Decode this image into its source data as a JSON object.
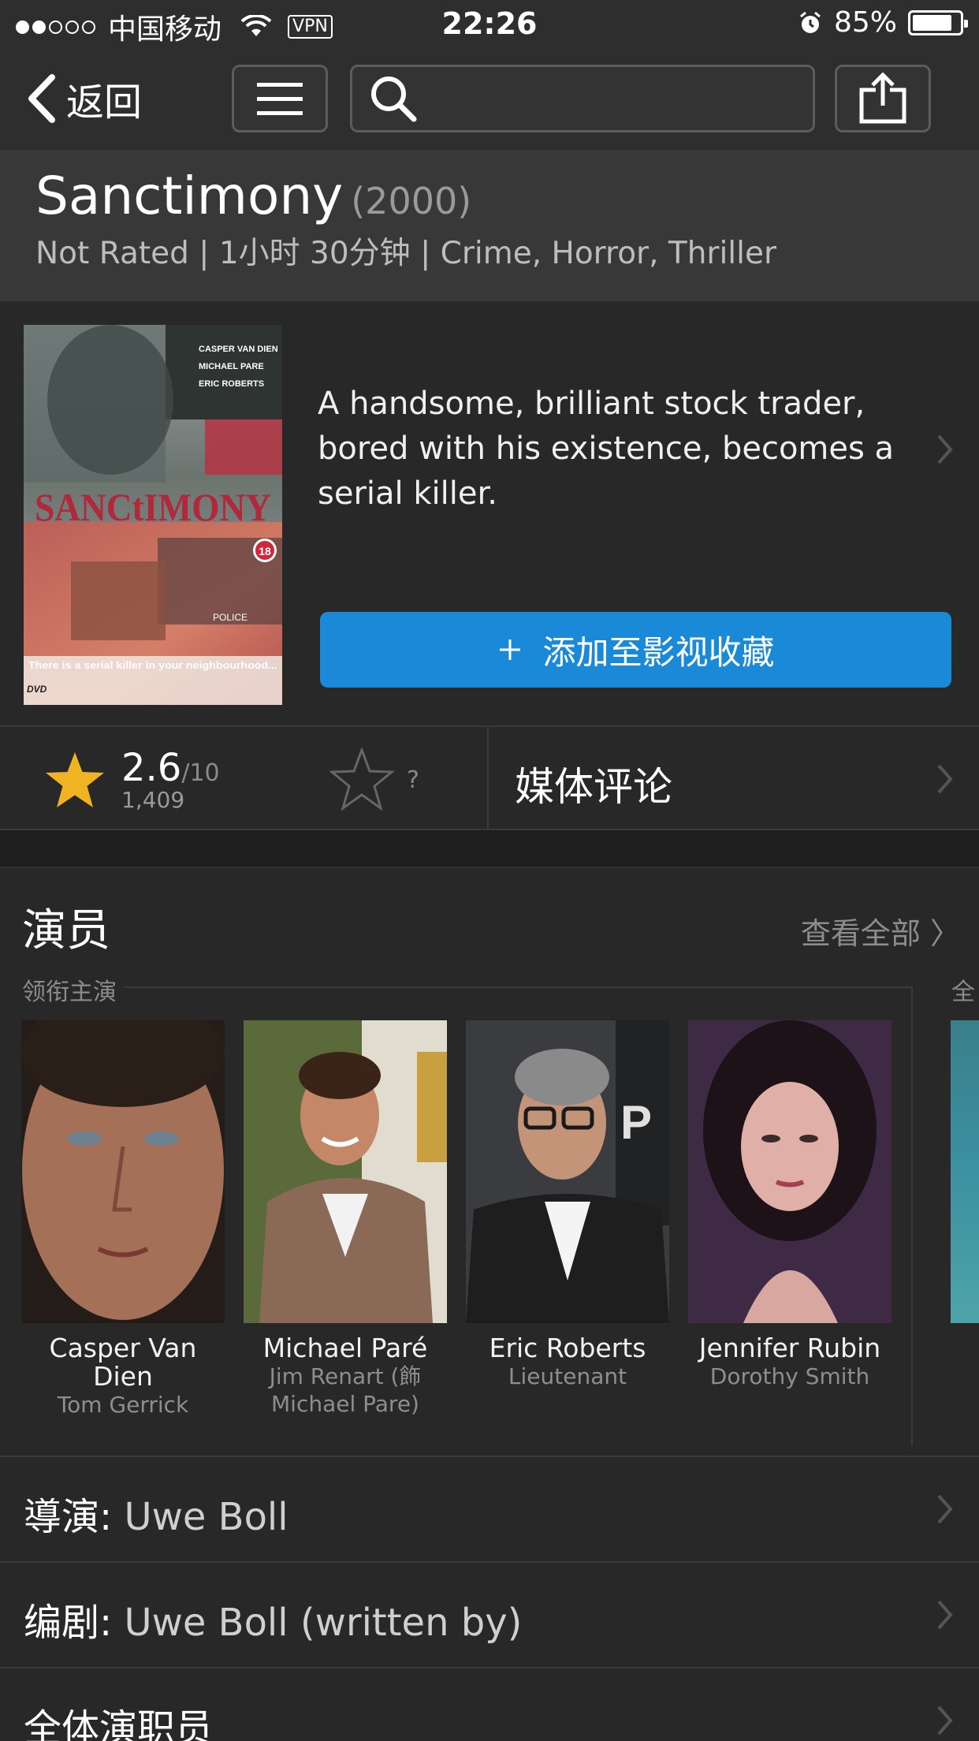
{
  "status_bar": {
    "carrier": "中国移动",
    "vpn": "VPN",
    "time": "22:26",
    "battery": "85%",
    "battery_level": 0.85
  },
  "nav": {
    "back_label": "返回",
    "search_placeholder": ""
  },
  "movie": {
    "title": "Sanctimony",
    "year": "(2000)",
    "meta": "Not Rated | 1小时 30分钟 | Crime, Horror, Thriller",
    "plot": "A handsome, brilliant stock trader, bored with his existence, becomes a serial killer.",
    "poster": {
      "credits": [
        "CASPER VAN DIEN",
        "MICHAEL PARE",
        "ERIC ROBERTS"
      ],
      "title": "SANCtIMONY",
      "rating_badge": "18",
      "tagline": "There is a serial killer in your neighbourhood...",
      "format": "DVD",
      "police_text": "POLICE"
    },
    "add_button": "添加至影视收藏",
    "add_icon": "plus-icon"
  },
  "rating": {
    "value": "2.6",
    "max": "/10",
    "count": "1,409",
    "user_rating": "?",
    "media_review": "媒体评论"
  },
  "cast": {
    "heading": "演员",
    "see_all": "查看全部 〉",
    "lead_label": "领衔主演",
    "next_label": "全",
    "members": [
      {
        "actor": "Casper Van Dien",
        "role": "Tom Gerrick"
      },
      {
        "actor": "Michael Paré",
        "role": "Jim Renart (飾 Michael Pare)"
      },
      {
        "actor": "Eric Roberts",
        "role": "Lieutenant"
      },
      {
        "actor": "Jennifer Rubin",
        "role": "Dorothy Smith"
      }
    ]
  },
  "credits": {
    "director_label": "導演:",
    "director": "Uwe Boll",
    "writer_label": "编剧:",
    "writer": "Uwe Boll (written by)",
    "full_cast": "全体演职员"
  },
  "colors": {
    "accent": "#1a8ad8",
    "star": "#f0b322",
    "background": "#282828"
  }
}
